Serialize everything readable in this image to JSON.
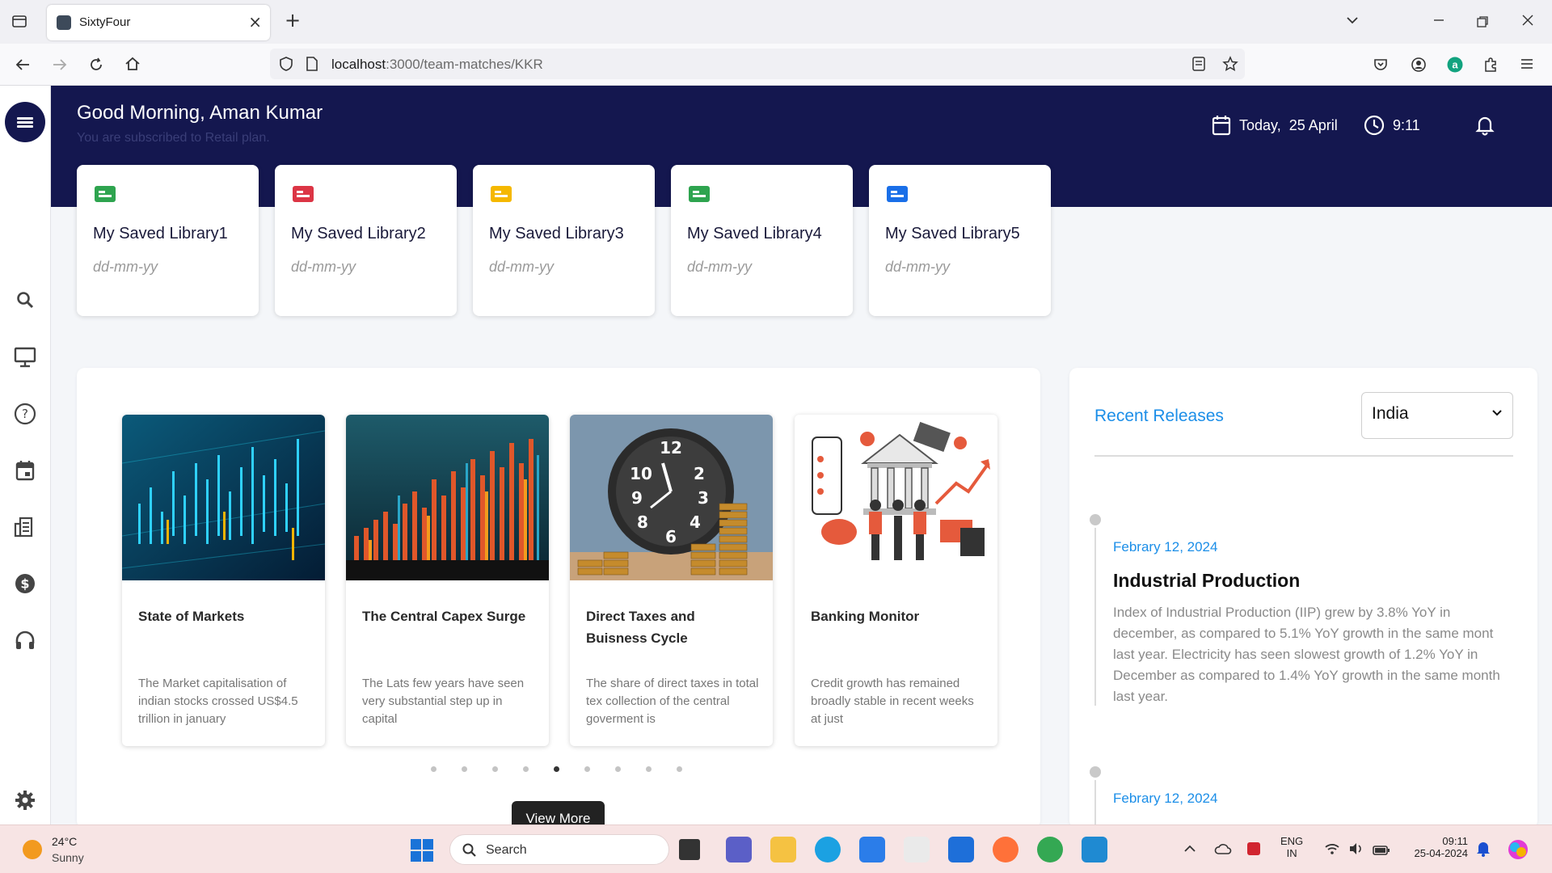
{
  "browser": {
    "tab_title": "SixtyFour",
    "url_host": "localhost",
    "url_path": ":3000/team-matches/KKR"
  },
  "header": {
    "greeting": "Good Morning, Aman Kumar",
    "subscription": "You are subscribed to Retail plan.",
    "today_label": "Today,",
    "date": "25 April",
    "time": "9:11"
  },
  "libraries": [
    {
      "name": "My Saved Library1",
      "date": "dd-mm-yy",
      "color": "#2ea44f"
    },
    {
      "name": "My Saved Library2",
      "date": "dd-mm-yy",
      "color": "#dc3545"
    },
    {
      "name": "My Saved Library3",
      "date": "dd-mm-yy",
      "color": "#f5b800"
    },
    {
      "name": "My Saved Library4",
      "date": "dd-mm-yy",
      "color": "#2ea44f"
    },
    {
      "name": "My Saved Library5",
      "date": "dd-mm-yy",
      "color": "#1a6fe8"
    }
  ],
  "articles": [
    {
      "title": "State of Markets",
      "desc": "The Market capitalisation of indian stocks crossed US$4.5 trillion in january"
    },
    {
      "title": "The Central Capex Surge",
      "desc": "The Lats few years have seen very substantial step up in capital"
    },
    {
      "title": "Direct Taxes and Buisness Cycle",
      "desc": "The share of direct taxes in total tex collection of the central goverment is"
    },
    {
      "title": "Banking Monitor",
      "desc": "Credit growth has remained broadly stable in recent weeks at just"
    }
  ],
  "carousel": {
    "dot_count": 9,
    "active_index": 4
  },
  "view_more_label": "View More",
  "recent": {
    "title": "Recent Releases",
    "country": "India",
    "releases": [
      {
        "date": "Febrary 12, 2024",
        "title": "Industrial Production",
        "body": "Index of Industrial Production (IIP) grew by 3.8% YoY in december, as compared to 5.1% YoY growth in the same mont last year. Electricity has seen slowest growth of 1.2% YoY in December as compared to 1.4% YoY growth in the same month last year."
      },
      {
        "date": "Febrary 12, 2024"
      }
    ]
  },
  "taskbar": {
    "temperature": "24°C",
    "condition": "Sunny",
    "search_label": "Search",
    "lang_top": "ENG",
    "lang_bottom": "IN",
    "clock_time": "09:11",
    "clock_date": "25-04-2024"
  }
}
